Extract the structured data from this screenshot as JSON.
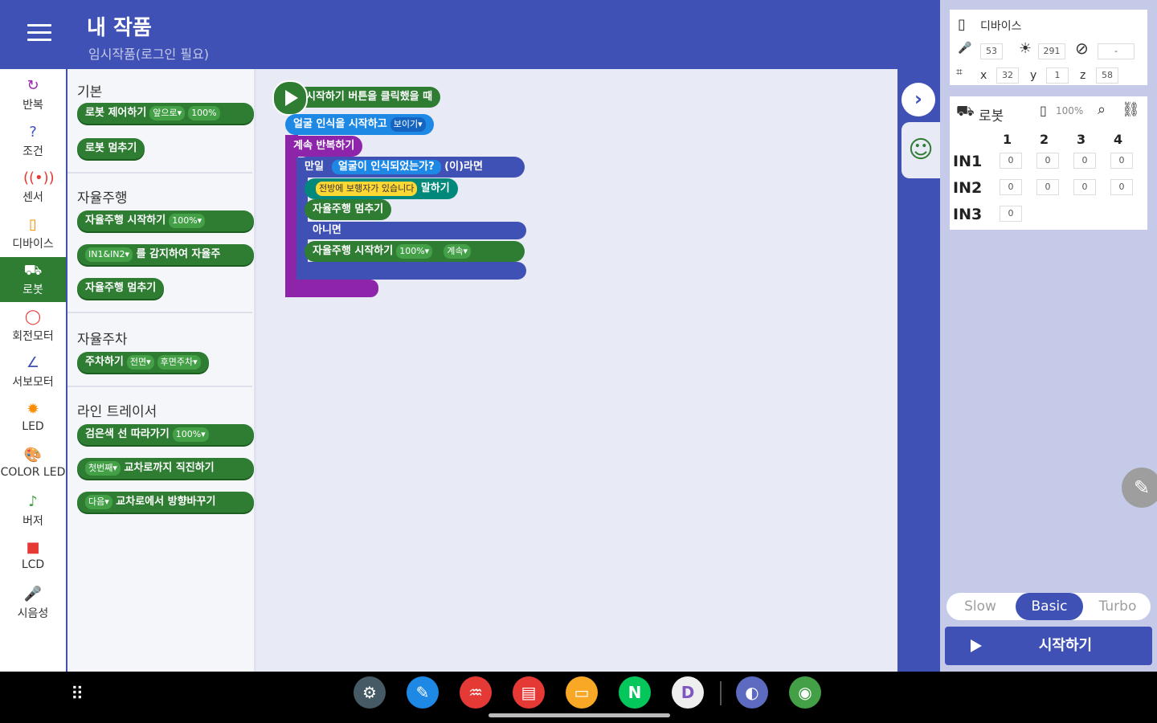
{
  "header": {
    "title": "내 작품",
    "subtitle": "임시작품(로그인 필요)"
  },
  "categories": [
    {
      "label": "반복",
      "icon": "↻",
      "color": "#9c27b0"
    },
    {
      "label": "조건",
      "icon": "?",
      "color": "#3f51b5"
    },
    {
      "label": "센서",
      "icon": "((•))",
      "color": "#e53935"
    },
    {
      "label": "디바이스",
      "icon": "▯",
      "color": "#fb8c00"
    },
    {
      "label": "로봇",
      "icon": "⛟",
      "color": "#ffffff",
      "selected": true
    },
    {
      "label": "회전모터",
      "icon": "◯",
      "color": "#e53935"
    },
    {
      "label": "서보모터",
      "icon": "∠",
      "color": "#3f51b5"
    },
    {
      "label": "LED",
      "icon": "✹",
      "color": "#fb8c00"
    },
    {
      "label": "COLOR LED",
      "icon": "🎨",
      "color": "#e53935"
    },
    {
      "label": "버저",
      "icon": "♪",
      "color": "#43a047"
    },
    {
      "label": "LCD",
      "icon": "■",
      "color": "#e53935"
    },
    {
      "label": "시음성",
      "icon": "🎤",
      "color": "#3f51b5"
    }
  ],
  "flyout": {
    "sections": [
      "기본",
      "자율주행",
      "자율주차",
      "라인 트레이서"
    ],
    "blocks": {
      "robot_control": "로봇 제어하기",
      "robot_control_dd": "앞으로▾",
      "robot_control_pct": "100%",
      "robot_stop": "로봇 멈추기",
      "auto_start": "자율주행 시작하기",
      "auto_start_pct": "100%▾",
      "detect_dd": "IN1&IN2▾",
      "detect": "를 감지하여 자율주",
      "auto_stop": "자율주행 멈추기",
      "park": "주차하기",
      "park_dd1": "전면▾",
      "park_dd2": "후면주차▾",
      "line_follow": "검은색 선 따라가기",
      "line_follow_pct": "100%▾",
      "cross_dd": "첫번째▾",
      "cross": "교차로까지 직진하기",
      "turn_dd": "다음▾",
      "turn": "교차로에서 방향바꾸기"
    }
  },
  "workspace": {
    "start": "시작하기 버튼을 클릭했을 때",
    "face_start": "얼굴 인식을 시작하고",
    "face_dd": "보이기▾",
    "loop": "계속 반복하기",
    "if": "만일",
    "face_detected": "얼굴이 인식되었는가?",
    "then": "(이)라면",
    "say_text": "전방에 보행자가 있습니다",
    "say": "말하기",
    "auto_stop": "자율주행 멈추기",
    "else": "아니면",
    "auto_start": "자율주행 시작하기",
    "auto_pct": "100%▾",
    "auto_mode": "계속▾"
  },
  "device_panel": {
    "title": "디바이스",
    "mic": "53",
    "light": "291",
    "rotate": "-",
    "x_label": "x",
    "x": "32",
    "y_label": "y",
    "y": "1",
    "z_label": "z",
    "z": "58"
  },
  "robot_panel": {
    "title": "로봇",
    "battery": "100%",
    "cols": [
      "1",
      "2",
      "3",
      "4"
    ],
    "rows": [
      {
        "label": "IN1",
        "values": [
          "0",
          "0",
          "0",
          "0"
        ]
      },
      {
        "label": "IN2",
        "values": [
          "0",
          "0",
          "0",
          "0"
        ]
      },
      {
        "label": "IN3",
        "values": [
          "0"
        ]
      }
    ]
  },
  "speed": {
    "options": [
      "Slow",
      "Basic",
      "Turbo"
    ],
    "selected": "Basic"
  },
  "start_button": "시작하기",
  "taskbar": {
    "apps": [
      {
        "name": "settings",
        "glyph": "⚙",
        "color": "#455a64"
      },
      {
        "name": "pen",
        "glyph": "✎",
        "color": "#1e88e5"
      },
      {
        "name": "voice-recorder",
        "glyph": "♒",
        "color": "#e53935"
      },
      {
        "name": "notes",
        "glyph": "▤",
        "color": "#e53935"
      },
      {
        "name": "files",
        "glyph": "▭",
        "color": "#f9a825"
      },
      {
        "name": "naver",
        "glyph": "N",
        "color": "#03c75a"
      },
      {
        "name": "d-app",
        "glyph": "D",
        "color": "#eeeeee"
      },
      {
        "name": "internet",
        "glyph": "◐",
        "color": "#5c6bc0"
      },
      {
        "name": "chrome",
        "glyph": "◉",
        "color": "#43a047"
      }
    ]
  }
}
